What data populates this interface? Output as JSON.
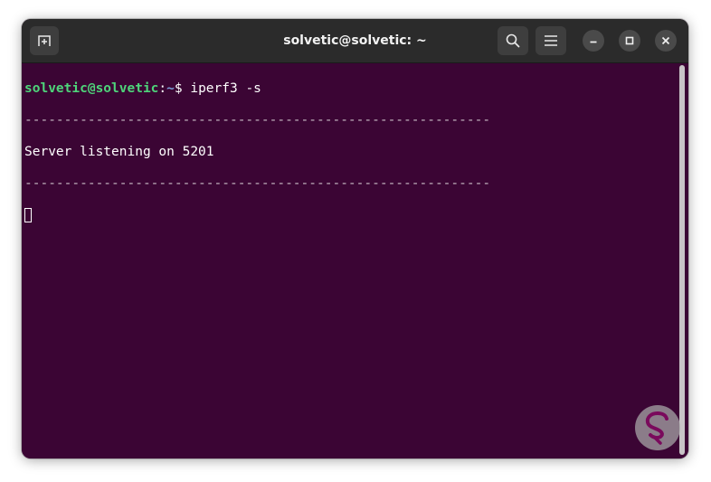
{
  "window": {
    "title": "solvetic@solvetic: ~"
  },
  "titlebar": {
    "new_tab_icon": "new-tab-icon",
    "search_icon": "search-icon",
    "menu_icon": "hamburger-menu-icon",
    "minimize_icon": "minimize-icon",
    "maximize_icon": "maximize-icon",
    "close_icon": "close-icon"
  },
  "terminal": {
    "prompt_user": "solvetic@solvetic",
    "prompt_sep": ":",
    "prompt_path": "~",
    "prompt_symbol": "$ ",
    "command": "iperf3 -s",
    "separator_1": "-----------------------------------------------------------",
    "output": "Server listening on 5201",
    "separator_2": "-----------------------------------------------------------"
  },
  "colors": {
    "terminal_bg": "#3b0534",
    "titlebar_bg": "#2b2b2b",
    "prompt_user": "#4ed47a",
    "prompt_path": "#7a9ed6"
  },
  "watermark_icon": "solvetic-logo-icon"
}
